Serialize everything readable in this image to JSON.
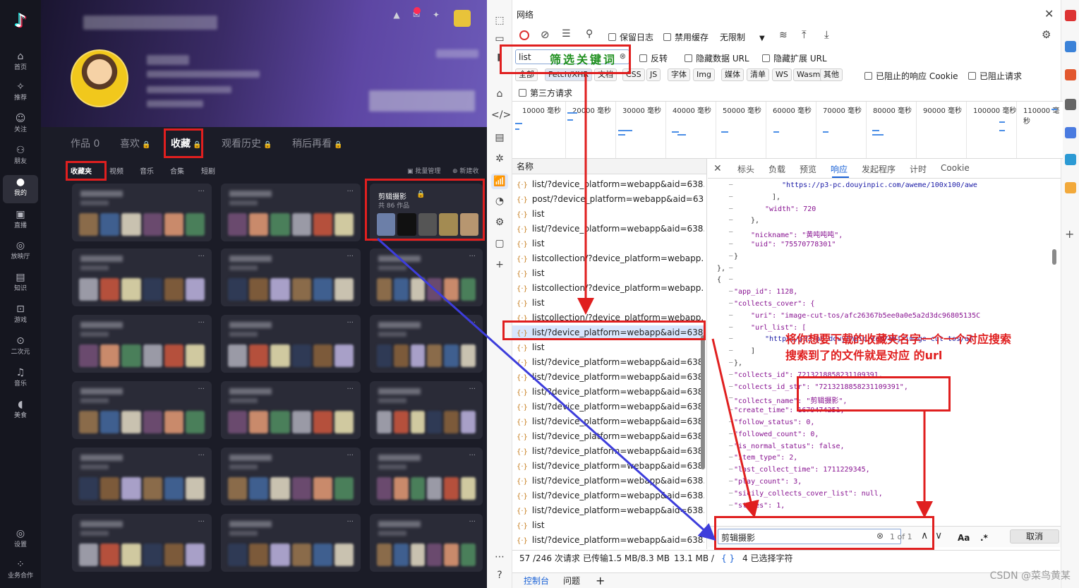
{
  "douyin": {
    "nav": [
      {
        "icon": "home-icon",
        "label": "首页"
      },
      {
        "icon": "recommend-icon",
        "label": "推荐"
      },
      {
        "icon": "follow-icon",
        "label": "关注"
      },
      {
        "icon": "friends-icon",
        "label": "朋友"
      },
      {
        "icon": "me-icon",
        "label": "我的"
      },
      {
        "icon": "live-icon",
        "label": "直播"
      },
      {
        "icon": "cinema-icon",
        "label": "放映厅"
      },
      {
        "icon": "knowledge-icon",
        "label": "知识"
      },
      {
        "icon": "game-icon",
        "label": "游戏"
      },
      {
        "icon": "anime-icon",
        "label": "二次元"
      },
      {
        "icon": "music-icon",
        "label": "音乐"
      },
      {
        "icon": "food-icon",
        "label": "美食"
      }
    ],
    "nav_bottom": [
      {
        "icon": "settings-icon",
        "label": "设置"
      },
      {
        "icon": "business-icon",
        "label": "业务合作"
      }
    ],
    "tabs": [
      "作品 0",
      "喜欢",
      "收藏",
      "观看历史",
      "稍后再看"
    ],
    "subtabs": [
      "收藏夹",
      "视频",
      "音乐",
      "合集",
      "短剧"
    ],
    "sub_actions": [
      "批量管理",
      "新建收"
    ],
    "featured_card": {
      "title": "剪辑摄影",
      "count": "共 86 作品"
    }
  },
  "devtools": {
    "title": "网络",
    "toolbar": {
      "preserve_log": "保留日志",
      "disable_cache": "禁用缓存",
      "throttle": "无限制"
    },
    "filter": {
      "value": "list",
      "annotation": "筛选关键词",
      "invert": "反转",
      "hide_data_url": "隐藏数据 URL",
      "hide_ext_url": "隐藏扩展 URL"
    },
    "type_chips": [
      "全部",
      "Fetch/XHR",
      "文档",
      "CSS",
      "JS",
      "字体",
      "Img",
      "媒体",
      "清单",
      "WS",
      "Wasm",
      "其他"
    ],
    "blocked_cookie": "已阻止的响应 Cookie",
    "blocked_req": "已阻止请求",
    "third_party": "第三方请求",
    "timeline_labels": [
      "10000 毫秒",
      "20000 毫秒",
      "30000 毫秒",
      "40000 毫秒",
      "50000 毫秒",
      "60000 毫秒",
      "70000 毫秒",
      "80000 毫秒",
      "90000 毫秒",
      "100000 毫秒",
      "110000 毫秒"
    ],
    "name_header": "名称",
    "requests": [
      "list/?device_platform=webapp&aid=638...",
      "post/?device_platform=webapp&aid=63...",
      "list",
      "list/?device_platform=webapp&aid=638...",
      "list",
      "listcollection/?device_platform=webapp...",
      "list",
      "listcollection/?device_platform=webapp...",
      "list",
      "listcollection/?device_platform=webapp...",
      "list/?device_platform=webapp&aid=638...",
      "list",
      "list/?device_platform=webapp&aid=638...",
      "list/?device_platform=webapp&aid=638...",
      "list/?device_platform=webapp&aid=638...",
      "list/?device_platform=webapp&aid=638...",
      "list/?device_platform=webapp&aid=638...",
      "list/?device_platform=webapp&aid=638...",
      "list/?device_platform=webapp&aid=638...",
      "list/?device_platform=webapp&aid=638...",
      "list/?device_platform=webapp&aid=638...",
      "list/?device_platform=webapp&aid=638...",
      "list/?device_platform=webapp&aid=638...",
      "list",
      "list/?device_platform=webapp&aid=638..."
    ],
    "detail_tabs": [
      "标头",
      "负载",
      "预览",
      "响应",
      "发起程序",
      "计时",
      "Cookie"
    ],
    "annotation": [
      "将你想要下载的收藏夹名字一个一个对应搜索",
      "搜索到了的文件就是对应 的url"
    ],
    "code_lines": [
      {
        "t": "\"https://p3-pc.douyinpic.com/aweme/100x100/awe",
        "c": "s",
        "i": 200
      },
      {
        "t": "],",
        "c": "p",
        "i": 186
      },
      {
        "t": "\"width\": 720",
        "c": "k",
        "i": 176
      },
      {
        "t": "},",
        "c": "p",
        "i": 156
      },
      {
        "t": "\"nickname\": \"黄吨吨吨\",",
        "c": "k",
        "i": 156
      },
      {
        "t": "\"uid\": \"75570778301\"",
        "c": "k",
        "i": 156
      },
      {
        "t": "}",
        "c": "p",
        "i": 132
      },
      {
        "t": "},",
        "c": "p",
        "i": 108
      },
      {
        "t": "{",
        "c": "p",
        "i": 108
      },
      {
        "t": "\"app_id\": 1128,",
        "c": "k",
        "i": 132
      },
      {
        "t": "\"collects_cover\": {",
        "c": "k",
        "i": 132
      },
      {
        "t": "\"uri\": \"image-cut-tos/afc26367b5ee0a0e5a2d3dc96805135C",
        "c": "k",
        "i": 156
      },
      {
        "t": "\"url_list\": [",
        "c": "k",
        "i": 156
      },
      {
        "t": "\"https://p3-pc.douyinpic.com/obj/image-cut-tos/af",
        "c": "s",
        "i": 176
      },
      {
        "t": "]",
        "c": "p",
        "i": 156
      },
      {
        "t": "},",
        "c": "p",
        "i": 132
      },
      {
        "t": "\"collects_id\": 7213218858231109391,",
        "c": "k",
        "i": 132
      },
      {
        "t": "\"collects_id_str\": \"7213218858231109391\",",
        "c": "k",
        "i": 132
      },
      {
        "t": "\"collects_name\": \"剪辑摄影\",",
        "c": "k",
        "i": 132
      },
      {
        "t": "\"create_time\": 1679474251,",
        "c": "k",
        "i": 132
      },
      {
        "t": "\"follow_status\": 0,",
        "c": "k",
        "i": 132
      },
      {
        "t": "\"followed_count\": 0,",
        "c": "k",
        "i": 132
      },
      {
        "t": "\"is_normal_status\": false,",
        "c": "k",
        "i": 132
      },
      {
        "t": "\"item_type\": 2,",
        "c": "k",
        "i": 132
      },
      {
        "t": "\"last_collect_time\": 1711229345,",
        "c": "k",
        "i": 132
      },
      {
        "t": "\"play_count\": 3,",
        "c": "k",
        "i": 132
      },
      {
        "t": "\"sicily_collects_cover_list\": null,",
        "c": "k",
        "i": 132
      },
      {
        "t": "\"states\": 1,",
        "c": "k",
        "i": 132
      }
    ],
    "search": {
      "value": "剪辑摄影",
      "count": "1 of 1",
      "case": "Aa",
      "regex": ".*",
      "cancel": "取消"
    },
    "status": {
      "requests": "57 /246 次请求",
      "transferred": "已传输1.5 MB/8.3 MB",
      "resources": "13.1 MB /",
      "selection": "4 已选择字符"
    },
    "bottom_tabs": [
      "控制台",
      "问题"
    ],
    "watermark": "CSDN @菜鸟黄某"
  },
  "colors": {
    "accent": "#1a62d6",
    "annotation_red": "#e01f1f",
    "annotation_green": "#1e8f1e",
    "annotation_blue": "#3d3ddb"
  }
}
